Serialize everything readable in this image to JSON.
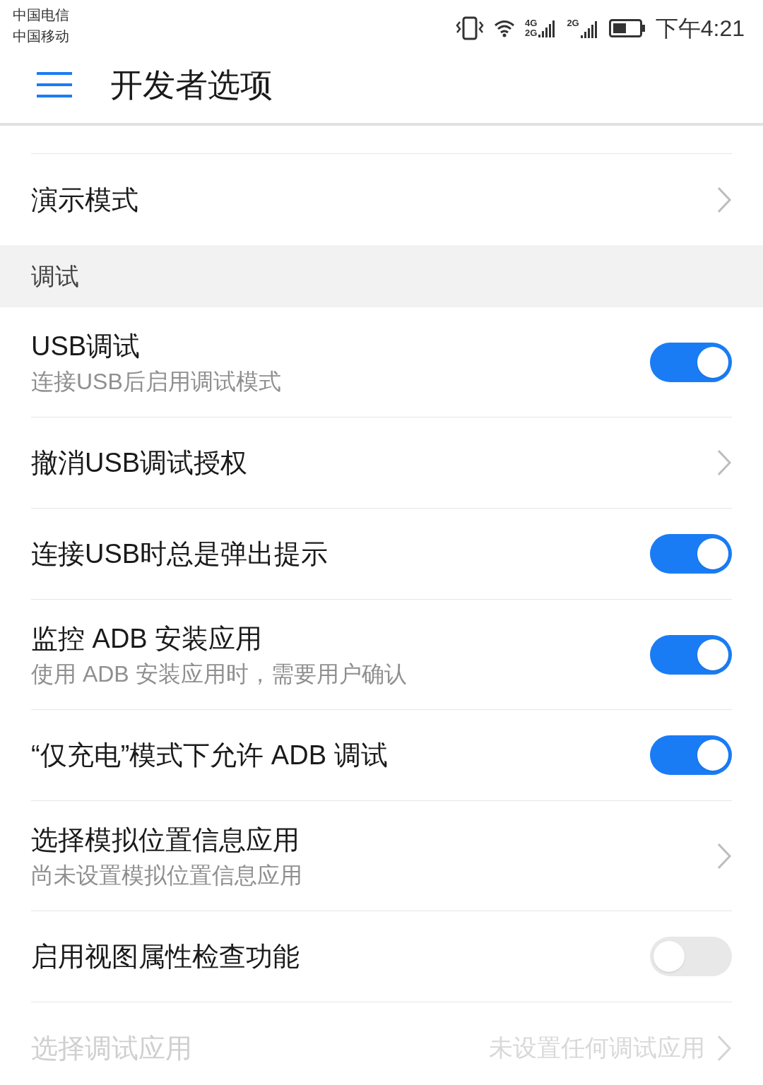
{
  "status_bar": {
    "carriers": [
      "中国电信",
      "中国移动"
    ],
    "network_labels": [
      "4G",
      "2G",
      "2G"
    ],
    "time": "下午4:21"
  },
  "header": {
    "title": "开发者选项"
  },
  "sections": [
    {
      "rows": [
        {
          "kind": "link",
          "title": "演示模式",
          "disabled": false
        }
      ]
    },
    {
      "heading": "调试",
      "rows": [
        {
          "kind": "toggle",
          "title": "USB调试",
          "subtitle": "连接USB后启用调试模式",
          "on": true,
          "disabled": false
        },
        {
          "kind": "link",
          "title": "撤消USB调试授权",
          "disabled": false
        },
        {
          "kind": "toggle",
          "title": "连接USB时总是弹出提示",
          "on": true,
          "disabled": false
        },
        {
          "kind": "toggle",
          "title": "监控 ADB 安装应用",
          "subtitle": "使用 ADB 安装应用时，需要用户确认",
          "on": true,
          "disabled": false
        },
        {
          "kind": "toggle",
          "title": "“仅充电”模式下允许 ADB 调试",
          "on": true,
          "disabled": false
        },
        {
          "kind": "link",
          "title": "选择模拟位置信息应用",
          "subtitle": "尚未设置模拟位置信息应用",
          "disabled": false
        },
        {
          "kind": "toggle",
          "title": "启用视图属性检查功能",
          "on": false,
          "disabled": false
        },
        {
          "kind": "link",
          "title": "选择调试应用",
          "value": "未设置任何调试应用",
          "disabled": true
        }
      ]
    }
  ]
}
